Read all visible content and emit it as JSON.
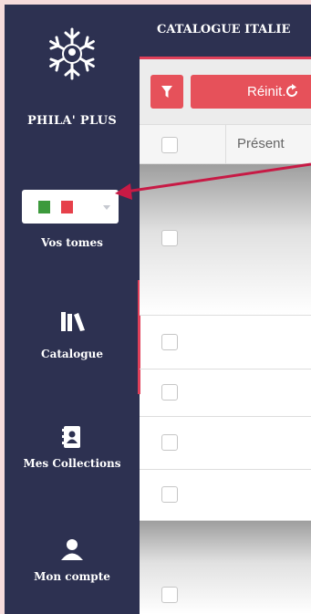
{
  "app": {
    "brand": "PHILA' PLUS"
  },
  "language": {
    "selected": "Italie",
    "flag_colors": [
      "#3c9a3c",
      "#ffffff",
      "#e6404a"
    ]
  },
  "nav": [
    {
      "label": "Vos tomes"
    },
    {
      "label": "Catalogue",
      "icon": "books-icon",
      "active": true
    },
    {
      "label": "Mes Collections",
      "icon": "address-book-icon"
    },
    {
      "label": "Mon compte",
      "icon": "user-icon"
    }
  ],
  "header": {
    "title": "CATALOGUE ITALIE"
  },
  "toolbar": {
    "filter_icon": "filter-icon",
    "reset_label": "Réinit.",
    "reset_icon": "refresh-icon"
  },
  "table": {
    "columns": [
      "",
      "Présent"
    ],
    "rows": 6
  },
  "colors": {
    "sidebar": "#2d3151",
    "accent": "#e0405a",
    "button": "#e6515a"
  }
}
